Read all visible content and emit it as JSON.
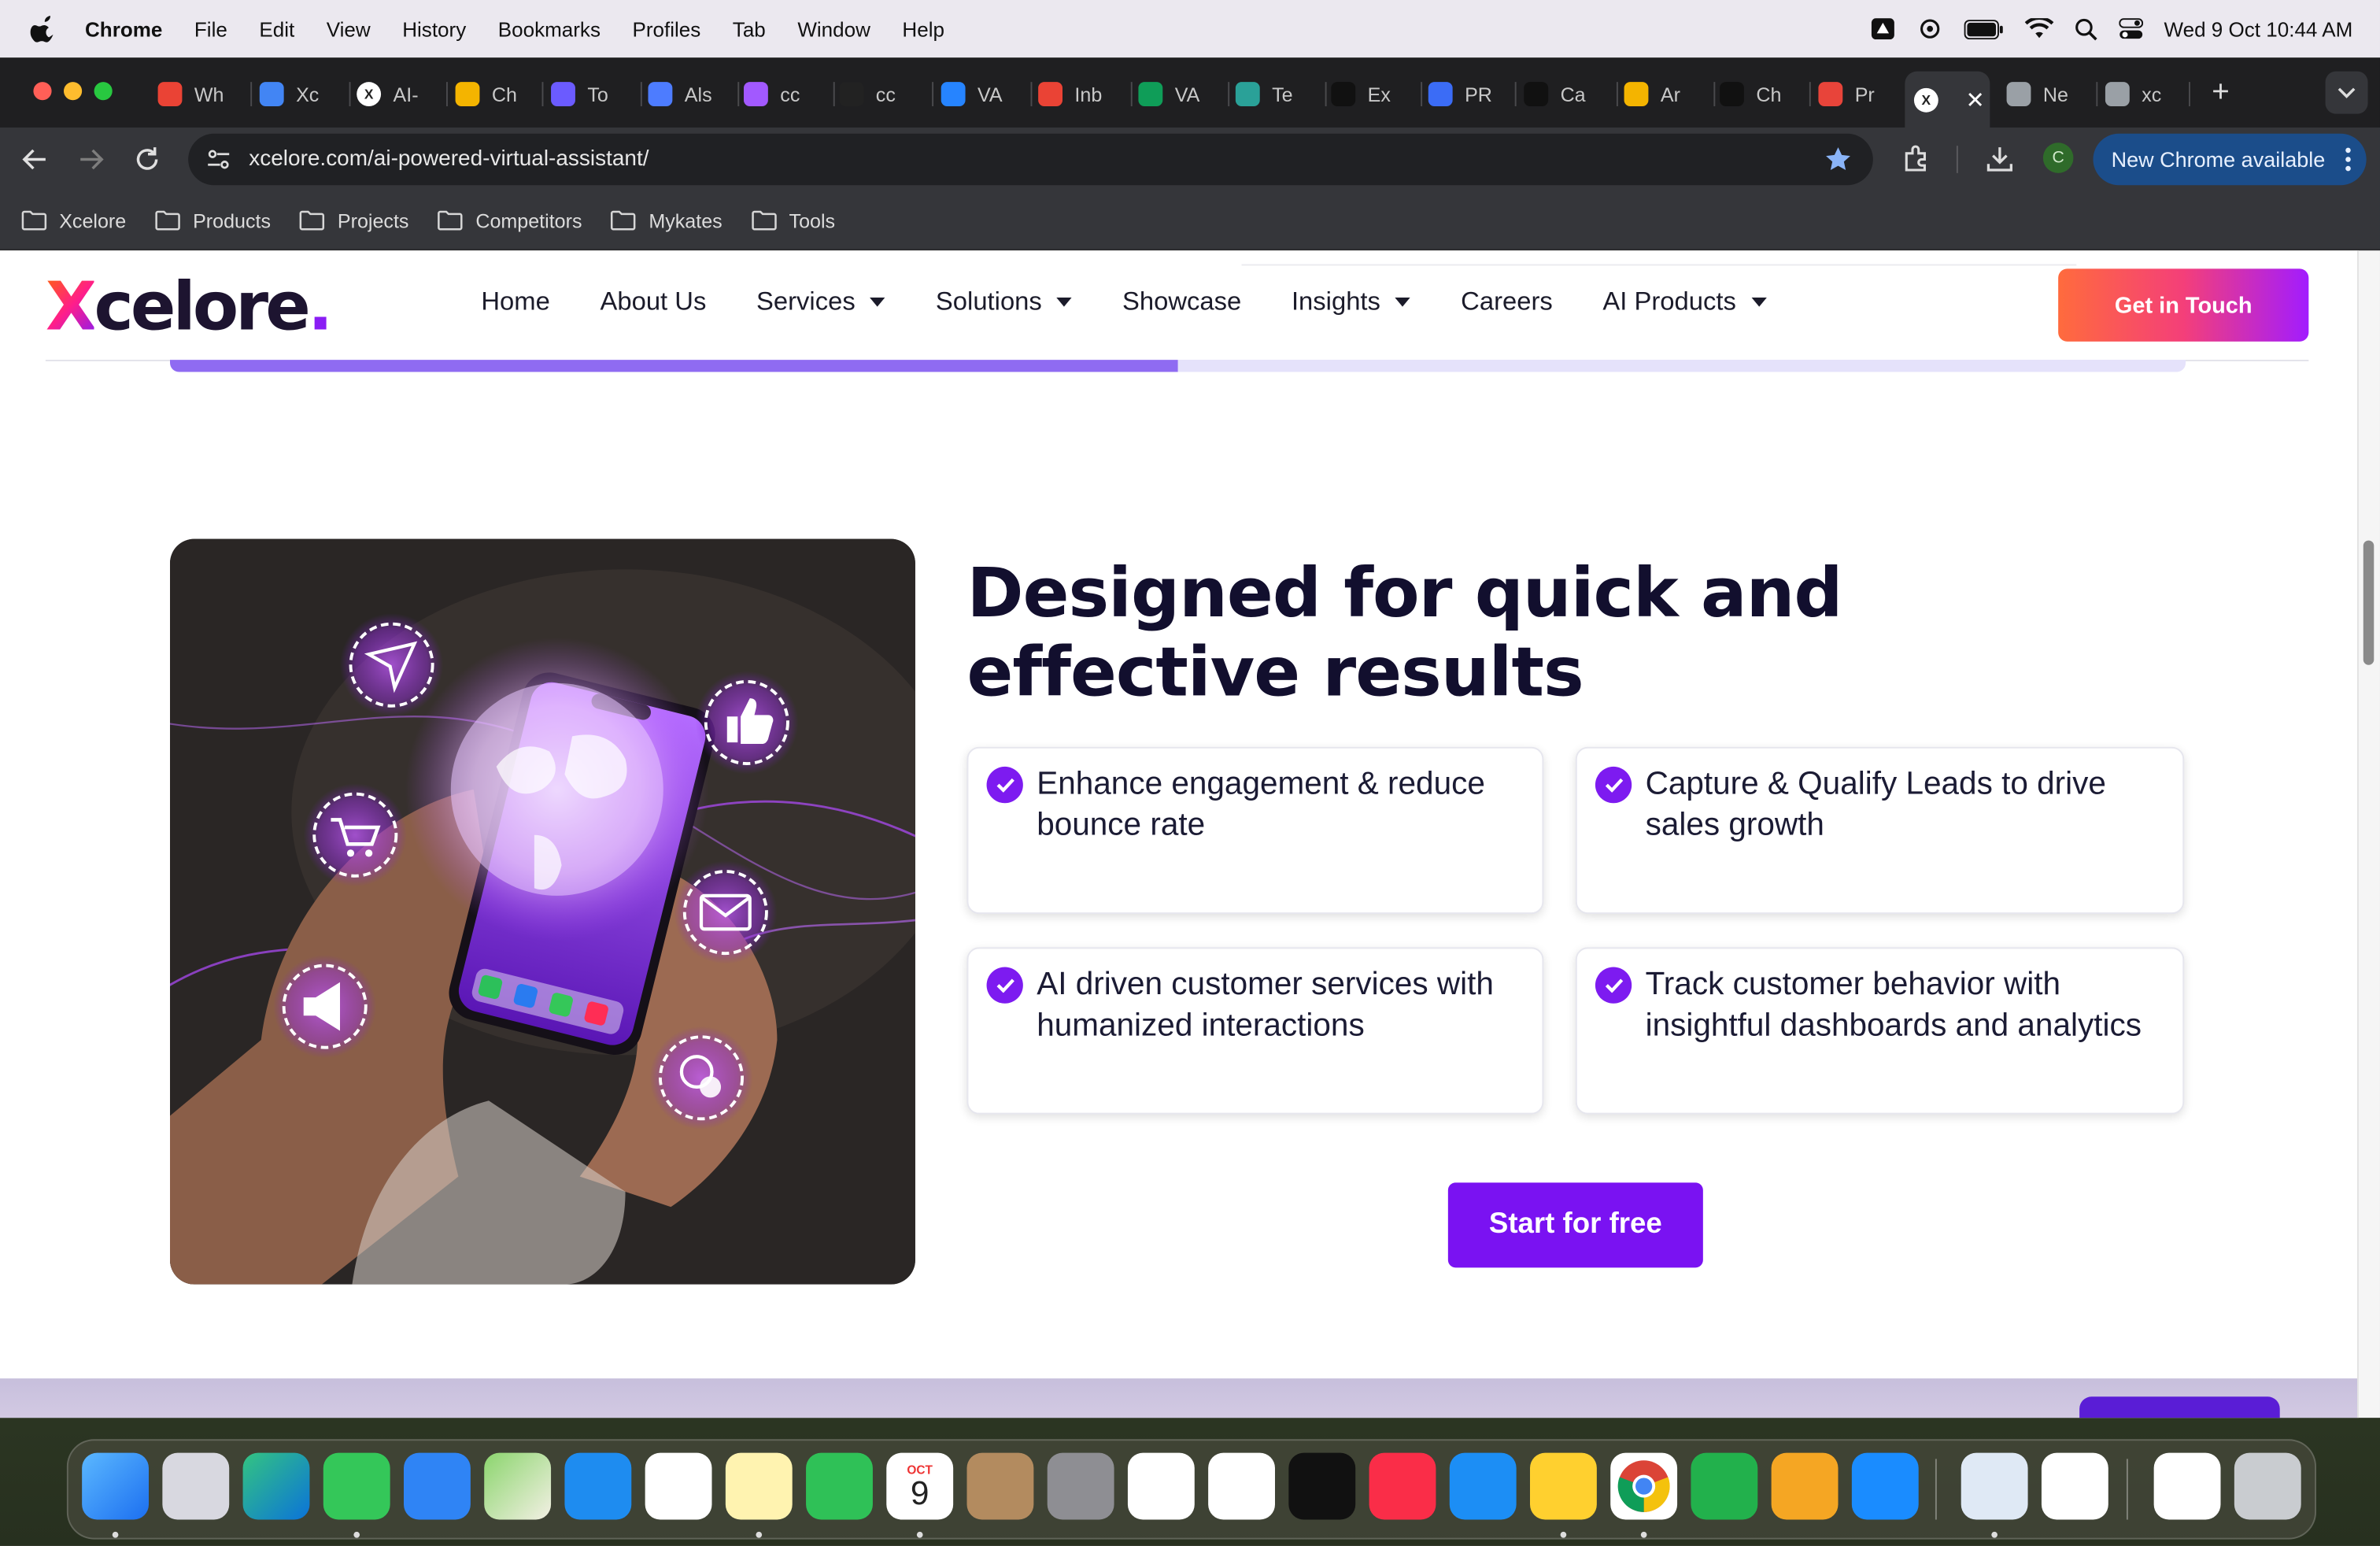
{
  "menubar": {
    "app": "Chrome",
    "items": [
      "File",
      "Edit",
      "View",
      "History",
      "Bookmarks",
      "Profiles",
      "Tab",
      "Window",
      "Help"
    ],
    "clock": "Wed 9 Oct  10:44 AM"
  },
  "tabs": [
    {
      "label": "Wh",
      "icon": "gmail-icon",
      "color": "#ea4335"
    },
    {
      "label": "Xc",
      "icon": "google-calendar-icon",
      "color": "#4285f4"
    },
    {
      "label": "AI-",
      "icon": "xcelore-icon",
      "color": "#ffffff"
    },
    {
      "label": "Ch",
      "icon": "slides-icon",
      "color": "#f4b400"
    },
    {
      "label": "To",
      "icon": "tool-icon",
      "color": "#6b5bff"
    },
    {
      "label": "Als",
      "icon": "a-logo-icon",
      "color": "#4d7cff"
    },
    {
      "label": "cc",
      "icon": "figma-icon",
      "color": "#a259ff"
    },
    {
      "label": "cc",
      "icon": "play-icon",
      "color": "#222222"
    },
    {
      "label": "VA",
      "icon": "jira-icon",
      "color": "#2684ff"
    },
    {
      "label": "Inb",
      "icon": "gmail-icon",
      "color": "#ea4335"
    },
    {
      "label": "VA",
      "icon": "sheets-icon",
      "color": "#0f9d58"
    },
    {
      "label": "Te",
      "icon": "globe-icon",
      "color": "#2aa198"
    },
    {
      "label": "Ex",
      "icon": "triangle-icon",
      "color": "#111111"
    },
    {
      "label": "PR",
      "icon": "list-icon",
      "color": "#3b6cf6"
    },
    {
      "label": "Ca",
      "icon": "chatgpt-icon",
      "color": "#111111"
    },
    {
      "label": "Ar",
      "icon": "slides-icon",
      "color": "#f4b400"
    },
    {
      "label": "Ch",
      "icon": "c-logo-icon",
      "color": "#111111"
    },
    {
      "label": "Pr",
      "icon": "p-logo-icon",
      "color": "#e8443a"
    },
    {
      "label": "",
      "icon": "xcelore-icon",
      "color": "#ffffff",
      "active": true
    },
    {
      "label": "Ne",
      "icon": "chrome-icon",
      "color": "#9aa0a6"
    },
    {
      "label": "xc",
      "icon": "globe-icon",
      "color": "#9aa0a6"
    }
  ],
  "address": {
    "url": "xcelore.com/ai-powered-virtual-assistant/"
  },
  "toolbar": {
    "update_label": "New Chrome available",
    "profile_initial": "C"
  },
  "bookmarks": [
    "Xcelore",
    "Products",
    "Projects",
    "Competitors",
    "Mykates",
    "Tools"
  ],
  "site": {
    "logo": "Xcelore",
    "nav": [
      {
        "label": "Home",
        "dropdown": false
      },
      {
        "label": "About Us",
        "dropdown": false
      },
      {
        "label": "Services",
        "dropdown": true
      },
      {
        "label": "Solutions",
        "dropdown": true
      },
      {
        "label": "Showcase",
        "dropdown": false
      },
      {
        "label": "Insights",
        "dropdown": true
      },
      {
        "label": "Careers",
        "dropdown": false
      },
      {
        "label": "AI Products",
        "dropdown": true
      }
    ],
    "cta": "Get in Touch",
    "scroll_progress": 0.5
  },
  "section": {
    "heading": "Designed for quick and effective results",
    "features": [
      "Enhance engagement & reduce bounce rate",
      "Capture & Qualify Leads to drive sales growth",
      "AI driven customer services with humanized interactions",
      "Track customer behavior with insightful dashboards and analytics"
    ],
    "button": "Start for free"
  },
  "colors": {
    "brand_purple": "#7a12f2",
    "heading": "#120f2e",
    "cta_gradient": [
      "#ff6b3d",
      "#f43f79",
      "#a21cff"
    ]
  },
  "dock": {
    "calendar_month": "OCT",
    "calendar_day": "9",
    "apps": [
      "finder-icon",
      "launchpad-icon",
      "edge-icon",
      "messages-icon",
      "mail-icon",
      "maps-icon",
      "safari-icon",
      "photos-icon",
      "notes-icon",
      "facetime-icon",
      "calendar-icon",
      "contacts-icon",
      "system-settings-icon",
      "reminders-icon",
      "freeform-icon",
      "appletv-icon",
      "music-icon",
      "keynote-icon",
      "miro-icon",
      "chrome-icon",
      "numbers-icon",
      "pages-icon",
      "appstore-icon",
      "preview-icon",
      "mongodb-icon",
      "xcelore-doc-icon",
      "trash-icon"
    ]
  }
}
